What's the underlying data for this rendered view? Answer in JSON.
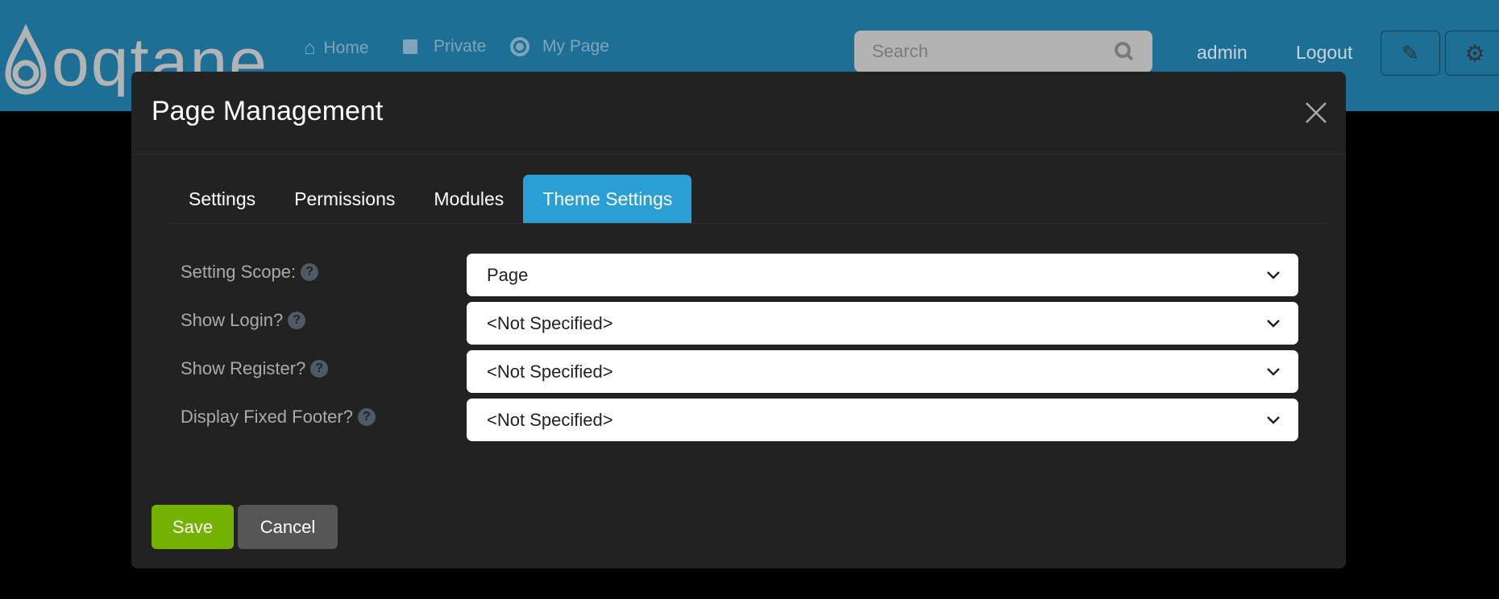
{
  "header": {
    "brand": "oqtane",
    "nav": [
      {
        "icon": "home-icon",
        "label": "Home"
      },
      {
        "icon": "lock-icon",
        "label": "Private"
      },
      {
        "icon": "target-icon",
        "label": "My Page"
      }
    ],
    "search_placeholder": "Search",
    "user": "admin",
    "logout": "Logout"
  },
  "modal": {
    "title": "Page Management",
    "tabs": [
      {
        "label": "Settings"
      },
      {
        "label": "Permissions"
      },
      {
        "label": "Modules"
      },
      {
        "label": "Theme Settings",
        "active": true
      }
    ],
    "fields": [
      {
        "label": "Setting Scope:",
        "value": "Page"
      },
      {
        "label": "Show Login?",
        "value": "<Not Specified>"
      },
      {
        "label": "Show Register?",
        "value": "<Not Specified>"
      },
      {
        "label": "Display Fixed Footer?",
        "value": "<Not Specified>"
      }
    ],
    "save": "Save",
    "cancel": "Cancel"
  },
  "colors": {
    "header": "#1e6f96",
    "active_tab": "#2a9fd6",
    "save": "#75b200",
    "cancel": "#555555",
    "modal": "#222222"
  }
}
